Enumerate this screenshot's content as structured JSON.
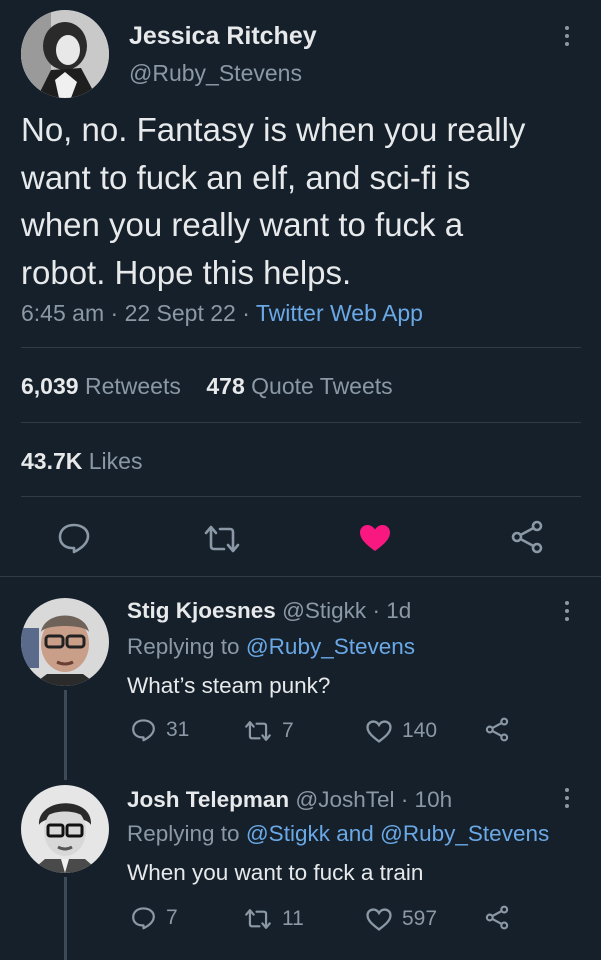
{
  "main_tweet": {
    "author_name": "Jessica Ritchey",
    "author_handle": "@Ruby_Stevens",
    "text_lines": [
      "No, no. Fantasy is when you really",
      "want to fuck an elf, and sci-fi is",
      "when you really want to fuck a",
      "robot. Hope this helps."
    ],
    "time": "6:45 am",
    "date": "22 Sept 22",
    "separator": "·",
    "source": "Twitter Web App",
    "retweets_count": "6,039",
    "retweets_label": "Retweets",
    "quotes_count": "478",
    "quotes_label": "Quote Tweets",
    "likes_count": "43.7K",
    "likes_label": "Likes",
    "liked": true,
    "like_color": "#f91880"
  },
  "replies": [
    {
      "author_name": "Stig Kjoesnes",
      "author_handle": "@Stigkk",
      "time_ago": "· 1d",
      "replying_prefix": "Replying to",
      "replying_to": "@Ruby_Stevens",
      "replying_and": "",
      "replying_to_2": "",
      "text": "What’s steam punk?",
      "reply_count": "31",
      "retweet_count": "7",
      "like_count": "140"
    },
    {
      "author_name": "Josh Telepman",
      "author_handle": "@JoshTel",
      "time_ago": "· 10h",
      "replying_prefix": "Replying to",
      "replying_to": "@Stigkk",
      "replying_and": "and",
      "replying_to_2": "@Ruby_Stevens",
      "text": "When you want to fuck a train",
      "reply_count": "7",
      "retweet_count": "11",
      "like_count": "597"
    }
  ]
}
